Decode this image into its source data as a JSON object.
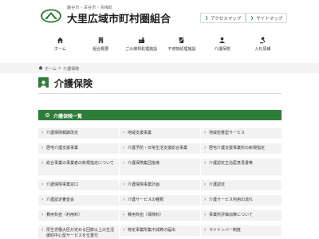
{
  "header": {
    "subtitle": "鹿谷市・深谷市・青梅町",
    "title": "大里広域市町村圏組合",
    "sitemap_buttons": [
      "アクセスマップ",
      "サイトマップ"
    ]
  },
  "nav": {
    "items": [
      {
        "label": "ホーム",
        "icon": "home-icon"
      },
      {
        "label": "組合概要",
        "icon": "building-icon"
      },
      {
        "label": "ごみ焼却処理施設",
        "icon": "factory-icon"
      },
      {
        "label": "不燃物処理施設",
        "icon": "recycle-icon"
      },
      {
        "label": "介護保険",
        "icon": "person-icon"
      },
      {
        "label": "入札情報",
        "icon": "gavel-icon"
      }
    ]
  },
  "breadcrumb": {
    "home": "ホーム",
    "separator": ">",
    "current": "介護保険"
  },
  "page_title": "介護保険",
  "section": {
    "title": "介護保険一覧",
    "items": [
      "介護保険報酬改定",
      "地域支援事業",
      "地域密着型サービス",
      "居宅介護支援事業",
      "介護予防・日常生活支援総合事業",
      "居宅介護支援事業所の新規指定",
      "総合事業の事業者の新規指定について",
      "介護保険集団指導",
      "介護認定主治医意見書等",
      "介護保険事業窓口",
      "介護保険事業計画",
      "介護認定",
      "介護認定審査会",
      "介護サービスの種類",
      "介護サービス利用の流れ",
      "費用負担（利用料）",
      "費用負担（保険料）",
      "事業所評価加算について",
      "厚生労働大臣が定める回数以上の生活援助中心型サービスを位置付",
      "特定事業所集中減算の届出",
      "マイナンバー制度"
    ]
  },
  "colors": {
    "accent": "#2f7d3a",
    "cell_bg": "#f2f2f2"
  }
}
